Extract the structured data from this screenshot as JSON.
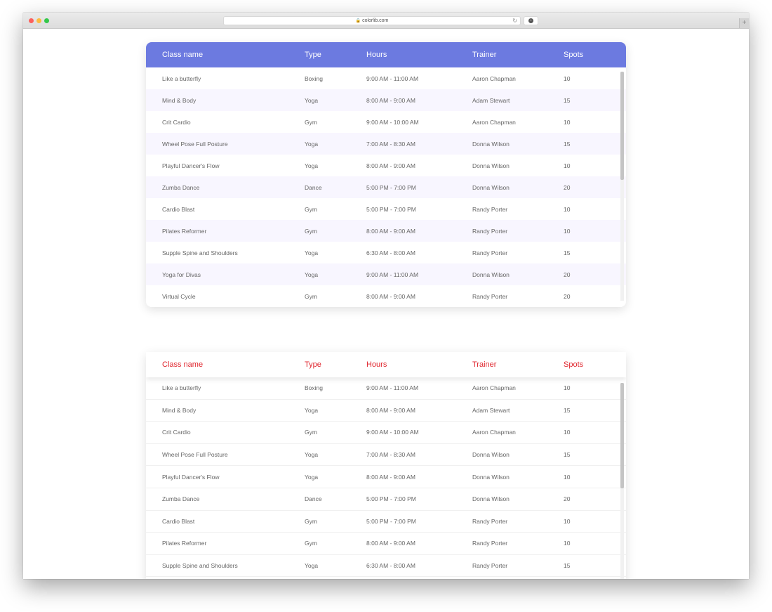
{
  "browser": {
    "url": "colorlib.com",
    "newtab_label": "+"
  },
  "columns": {
    "name": "Class name",
    "type": "Type",
    "hours": "Hours",
    "trainer": "Trainer",
    "spots": "Spots"
  },
  "colors": {
    "header_purple": "#6c7ae0",
    "header_red_text": "#e0262e",
    "row_alt": "#f8f6ff"
  },
  "rows": [
    {
      "name": "Like a butterfly",
      "type": "Boxing",
      "hours": "9:00 AM - 11:00 AM",
      "trainer": "Aaron Chapman",
      "spots": "10"
    },
    {
      "name": "Mind & Body",
      "type": "Yoga",
      "hours": "8:00 AM - 9:00 AM",
      "trainer": "Adam Stewart",
      "spots": "15"
    },
    {
      "name": "Crit Cardio",
      "type": "Gym",
      "hours": "9:00 AM - 10:00 AM",
      "trainer": "Aaron Chapman",
      "spots": "10"
    },
    {
      "name": "Wheel Pose Full Posture",
      "type": "Yoga",
      "hours": "7:00 AM - 8:30 AM",
      "trainer": "Donna Wilson",
      "spots": "15"
    },
    {
      "name": "Playful Dancer's Flow",
      "type": "Yoga",
      "hours": "8:00 AM - 9:00 AM",
      "trainer": "Donna Wilson",
      "spots": "10"
    },
    {
      "name": "Zumba Dance",
      "type": "Dance",
      "hours": "5:00 PM - 7:00 PM",
      "trainer": "Donna Wilson",
      "spots": "20"
    },
    {
      "name": "Cardio Blast",
      "type": "Gym",
      "hours": "5:00 PM - 7:00 PM",
      "trainer": "Randy Porter",
      "spots": "10"
    },
    {
      "name": "Pilates Reformer",
      "type": "Gym",
      "hours": "8:00 AM - 9:00 AM",
      "trainer": "Randy Porter",
      "spots": "10"
    },
    {
      "name": "Supple Spine and Shoulders",
      "type": "Yoga",
      "hours": "6:30 AM - 8:00 AM",
      "trainer": "Randy Porter",
      "spots": "15"
    },
    {
      "name": "Yoga for Divas",
      "type": "Yoga",
      "hours": "9:00 AM - 11:00 AM",
      "trainer": "Donna Wilson",
      "spots": "20"
    },
    {
      "name": "Virtual Cycle",
      "type": "Gym",
      "hours": "8:00 AM - 9:00 AM",
      "trainer": "Randy Porter",
      "spots": "20"
    }
  ],
  "table1_visible_rows": 11,
  "table2_visible_rows": 9
}
